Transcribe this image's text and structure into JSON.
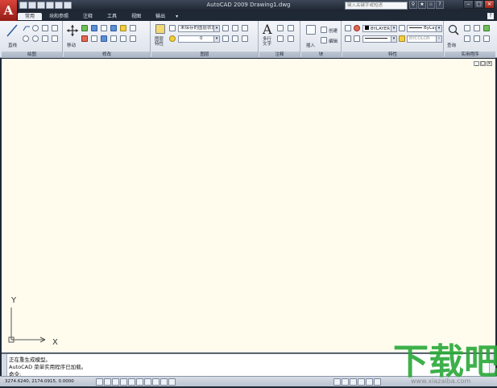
{
  "window": {
    "app_title": "AutoCAD 2009  Drawing1.dwg",
    "search_placeholder": "键入关键字或短语",
    "help_label": "?"
  },
  "logo": {
    "letter": "A"
  },
  "tabs": [
    {
      "label": "常用",
      "active": true
    },
    {
      "label": "块和参照",
      "active": false
    },
    {
      "label": "注释",
      "active": false
    },
    {
      "label": "工具",
      "active": false
    },
    {
      "label": "视图",
      "active": false
    },
    {
      "label": "输出",
      "active": false
    }
  ],
  "ribbon": {
    "draw": {
      "title": "绘图",
      "line_label": "直线"
    },
    "modify": {
      "title": "修改",
      "move_label": "移动"
    },
    "layers": {
      "title": "图层",
      "layer_props_label": "图层\n特性",
      "layer_state_value": "未保存的图层状态",
      "current_layer_value": "0"
    },
    "annotation": {
      "title": "注释",
      "mtext_label": "多行\n文字"
    },
    "block": {
      "title": "块",
      "insert_label": "插入",
      "create_label": "创建",
      "edit_label": "编辑"
    },
    "properties": {
      "title": "特性",
      "color_value": "BYLAYER",
      "linetype_value": "ByLay",
      "linecolor_value": "BYCOLOR"
    },
    "utilities": {
      "title": "实用程序",
      "measure_label": "查询"
    }
  },
  "command": {
    "lines": [
      "正在重生成模型。",
      "AutoCAD 菜单实用程序已加载。",
      "命令:"
    ]
  },
  "ucs": {
    "x_label": "X",
    "y_label": "Y"
  },
  "status": {
    "coords": "3274.6240, 2174.0915, 0.0000"
  },
  "watermark": {
    "text": "下载吧",
    "url": "www.xiazaiba.com"
  },
  "colors": {
    "canvas": "#fffcee",
    "accent": "#c4302b"
  }
}
